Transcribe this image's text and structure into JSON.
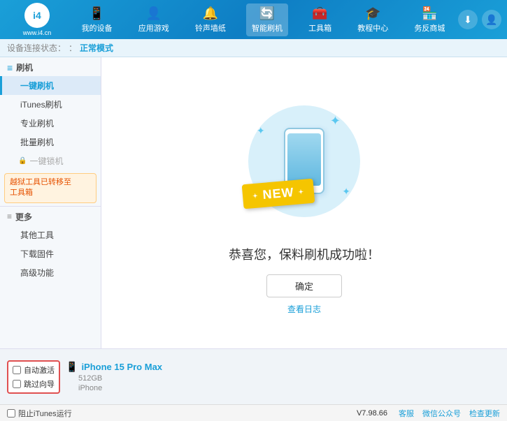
{
  "app": {
    "logo_text": "www.i4.cn",
    "logo_icon": "i4"
  },
  "nav": {
    "items": [
      {
        "id": "my-device",
        "icon": "📱",
        "label": "我的设备"
      },
      {
        "id": "apps-games",
        "icon": "👤",
        "label": "应用游戏"
      },
      {
        "id": "ringtones",
        "icon": "🔔",
        "label": "铃声墙纸"
      },
      {
        "id": "smart-flash",
        "icon": "🔄",
        "label": "智能刷机",
        "active": true
      },
      {
        "id": "toolbox",
        "icon": "🧰",
        "label": "工具箱"
      },
      {
        "id": "tutorial",
        "icon": "🎓",
        "label": "教程中心"
      },
      {
        "id": "service",
        "icon": "🏪",
        "label": "务反商城"
      }
    ]
  },
  "status_bar": {
    "label": "设备连接状态：",
    "value": "正常模式"
  },
  "sidebar": {
    "section_flash": "刷机",
    "items": [
      {
        "id": "one-key-flash",
        "label": "一键刷机",
        "active": true
      },
      {
        "id": "itunes-flash",
        "label": "iTunes刷机"
      },
      {
        "id": "pro-flash",
        "label": "专业刷机"
      },
      {
        "id": "batch-flash",
        "label": "批量刷机"
      }
    ],
    "disabled_label": "一键锁机",
    "notice": "越狱工具已转移至\n工具箱",
    "section_more": "更多",
    "more_items": [
      {
        "id": "other-tools",
        "label": "其他工具"
      },
      {
        "id": "download-fw",
        "label": "下载固件"
      },
      {
        "id": "advanced",
        "label": "高级功能"
      }
    ]
  },
  "content": {
    "success_message": "恭喜您，保料刷机成功啦！",
    "confirm_button": "确定",
    "log_link": "查看日志"
  },
  "illustration": {
    "new_badge": "NEW",
    "sparkles": [
      "✦",
      "✦",
      "✦"
    ]
  },
  "device_bar": {
    "checkbox1_label": "自动激活",
    "checkbox2_label": "跳过向导",
    "device_name": "iPhone 15 Pro Max",
    "device_storage": "512GB",
    "device_type": "iPhone"
  },
  "bottom": {
    "itunes_label": "阻止iTunes运行",
    "version": "V7.98.66",
    "links": [
      "客服",
      "微信公众号",
      "检查更新"
    ]
  }
}
